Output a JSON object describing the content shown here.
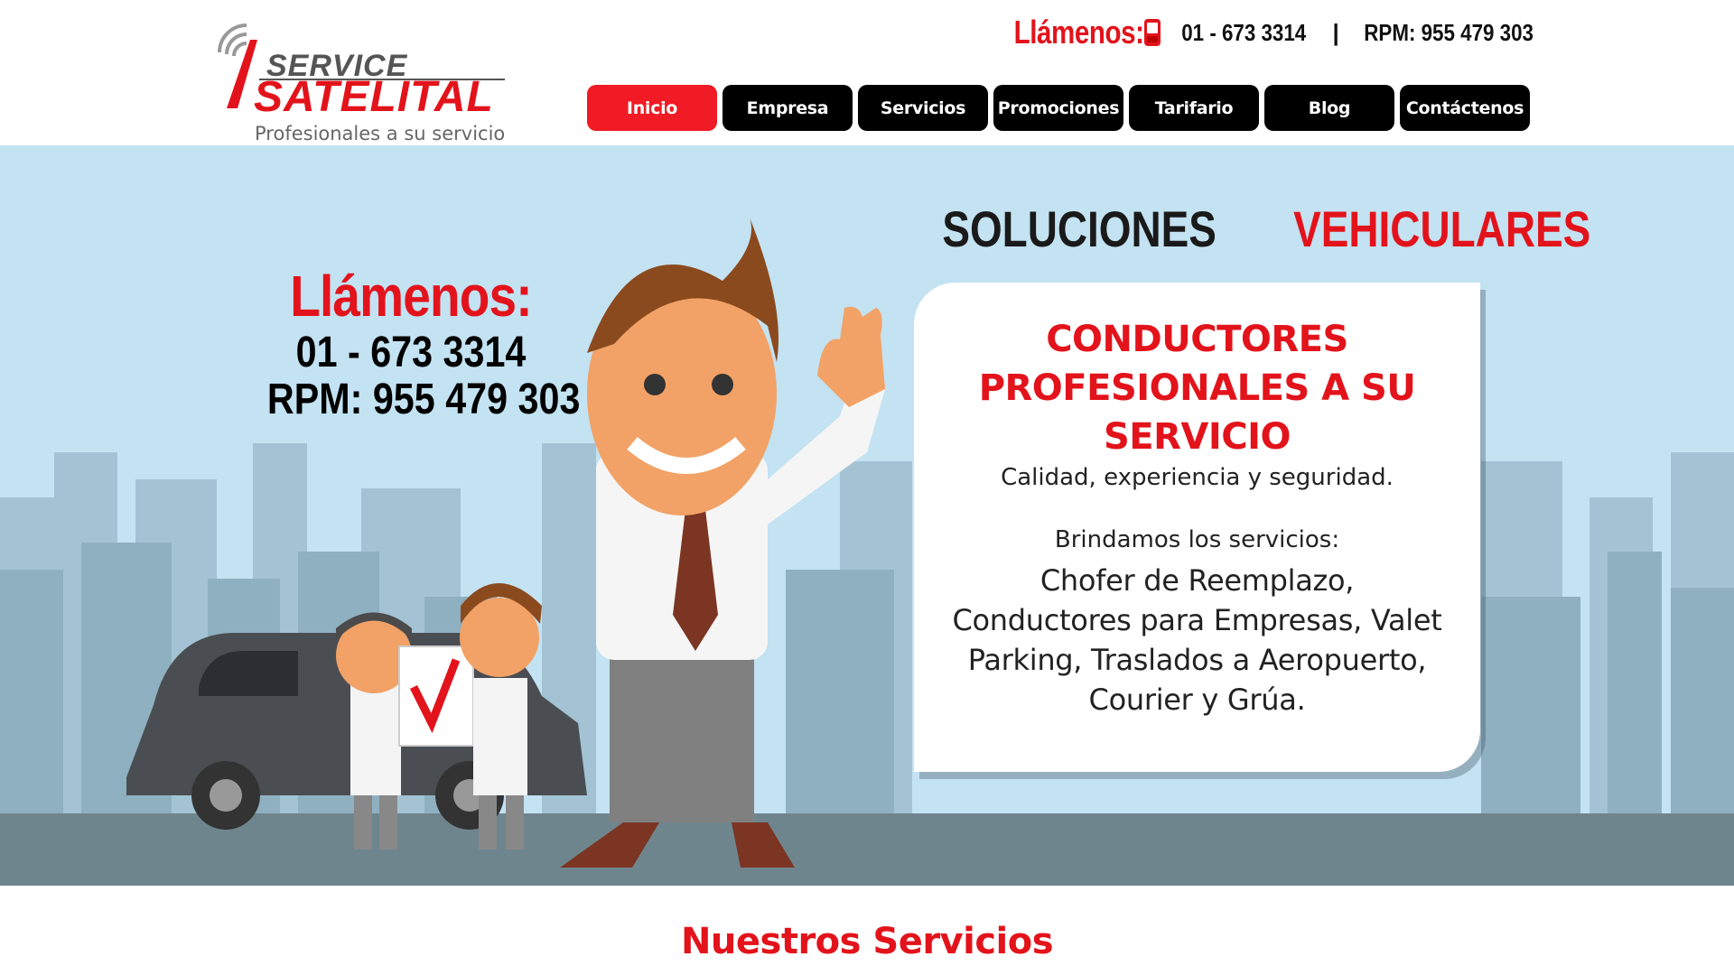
{
  "logo": {
    "line1": "SERVICE",
    "line2": "SATELITAL",
    "tagline": "Profesionales a su servicio"
  },
  "topbar": {
    "call_label": "Llámenos:",
    "phone": "01 - 673 3314",
    "separator": "|",
    "rpm": "RPM: 955 479 303"
  },
  "nav": {
    "items": [
      {
        "label": "Inicio",
        "active": true
      },
      {
        "label": "Empresa"
      },
      {
        "label": "Servicios"
      },
      {
        "label": "Promociones"
      },
      {
        "label": "Tarifario"
      },
      {
        "label": "Blog"
      },
      {
        "label": "Contáctenos"
      }
    ]
  },
  "hero": {
    "call_title": "Llámenos:",
    "call_phone": "01 - 673 3314",
    "call_rpm": "RPM: 955 479 303",
    "heading_dark": "SOLUCIONES",
    "heading_red": "VEHICULARES",
    "card": {
      "title": "CONDUCTORES PROFESIONALES A SU SERVICIO",
      "subtitle": "Calidad, experiencia y seguridad.",
      "lead": "Brindamos los servicios:",
      "services": "Chofer de Reemplazo, Conductores para Empresas, Valet Parking, Traslados a Aeropuerto, Courier y Grúa."
    }
  },
  "section": {
    "title": "Nuestros Servicios"
  },
  "colors": {
    "brand_red": "#e3131b",
    "nav_active": "#f01b24",
    "nav_bg": "#000000",
    "hero_sky": "#c3e2f2",
    "hero_ground": "#6f858e"
  }
}
